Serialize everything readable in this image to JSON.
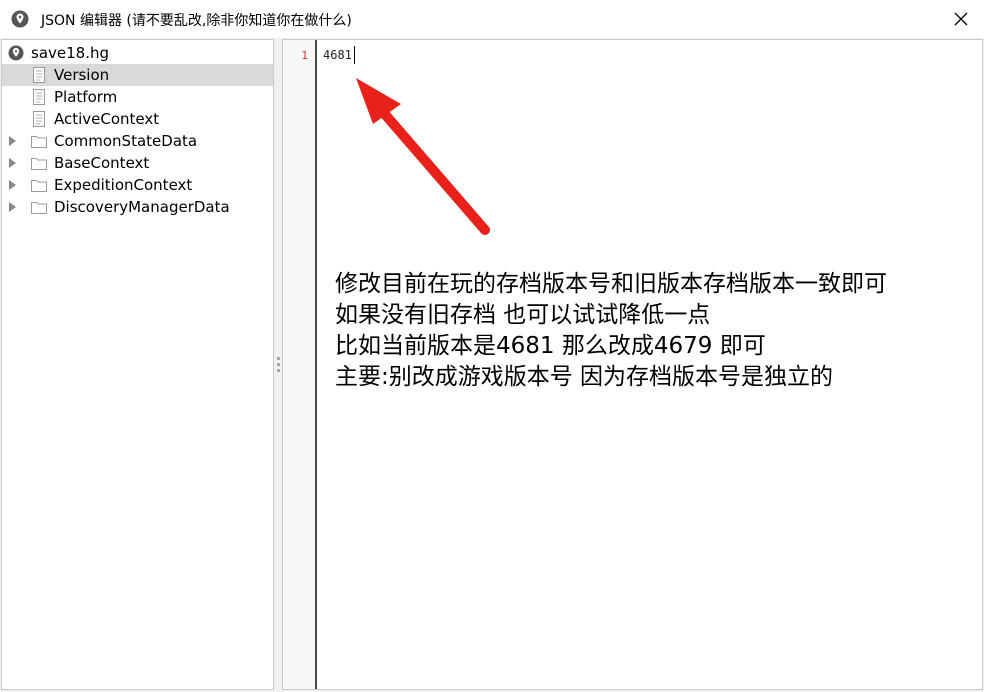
{
  "window": {
    "title": "JSON 编辑器 (请不要乱改,除非你知道你在做什么)",
    "close_icon": "close-icon",
    "app_icon": "map-pin-icon"
  },
  "tree": {
    "root": {
      "label": "save18.hg",
      "icon": "map-pin-icon"
    },
    "items": [
      {
        "label": "Version",
        "icon": "file-icon",
        "selected": true,
        "expandable": false
      },
      {
        "label": "Platform",
        "icon": "file-icon",
        "selected": false,
        "expandable": false
      },
      {
        "label": "ActiveContext",
        "icon": "file-icon",
        "selected": false,
        "expandable": false
      },
      {
        "label": "CommonStateData",
        "icon": "folder-icon",
        "selected": false,
        "expandable": true
      },
      {
        "label": "BaseContext",
        "icon": "folder-icon",
        "selected": false,
        "expandable": true
      },
      {
        "label": "ExpeditionContext",
        "icon": "folder-icon",
        "selected": false,
        "expandable": true
      },
      {
        "label": "DiscoveryManagerData",
        "icon": "folder-icon",
        "selected": false,
        "expandable": true
      }
    ]
  },
  "editor": {
    "line_numbers": [
      "1"
    ],
    "lines": [
      "4681"
    ]
  },
  "annotation": {
    "arrow_color": "#e8221b",
    "lines": [
      "修改目前在玩的存档版本号和旧版本存档版本一致即可",
      "如果没有旧存档 也可以试试降低一点",
      "比如当前版本是4681  那么改成4679 即可",
      "主要:别改成游戏版本号 因为存档版本号是独立的"
    ]
  }
}
